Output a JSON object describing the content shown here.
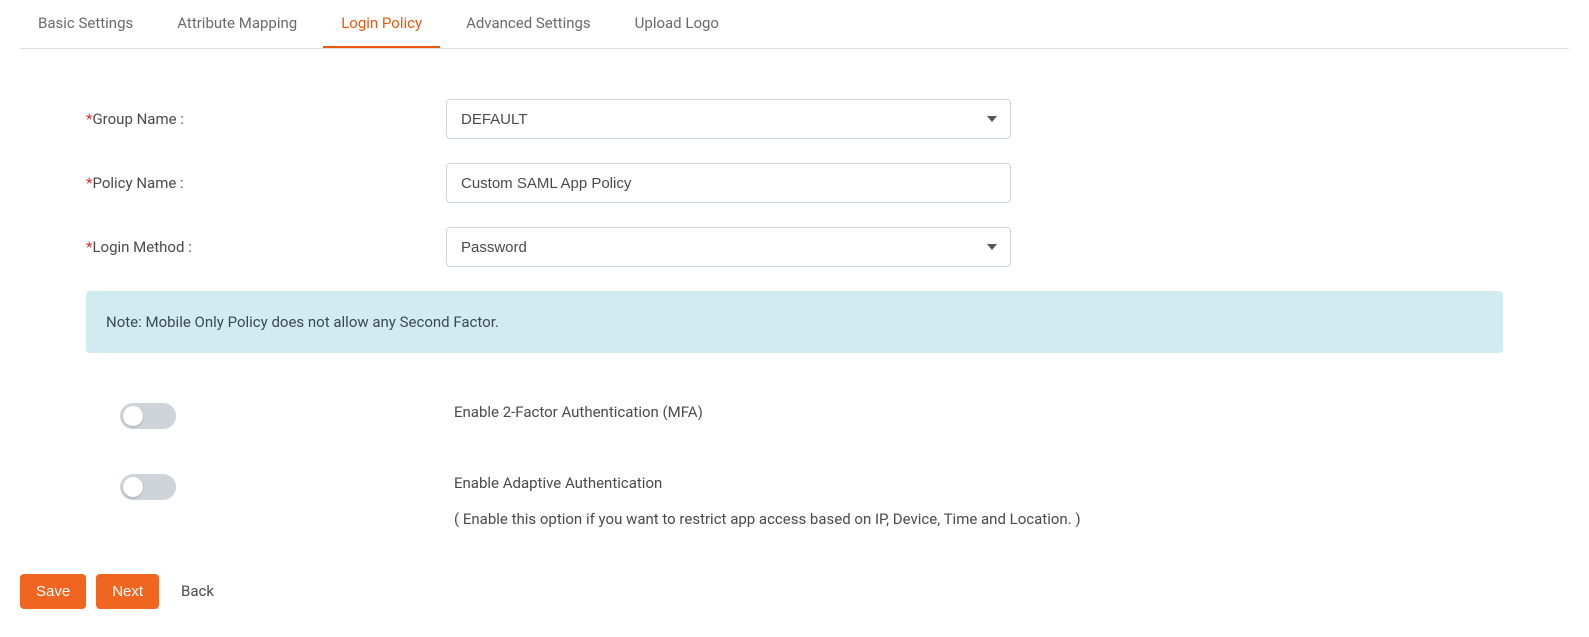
{
  "tabs": [
    {
      "label": "Basic Settings",
      "active": false
    },
    {
      "label": "Attribute Mapping",
      "active": false
    },
    {
      "label": "Login Policy",
      "active": true
    },
    {
      "label": "Advanced Settings",
      "active": false
    },
    {
      "label": "Upload Logo",
      "active": false
    }
  ],
  "form": {
    "group_name": {
      "label": "Group Name :",
      "value": "DEFAULT"
    },
    "policy_name": {
      "label": "Policy Name :",
      "value": "Custom SAML App Policy"
    },
    "login_method": {
      "label": "Login Method :",
      "value": "Password"
    }
  },
  "note": "Note: Mobile Only Policy does not allow any Second Factor.",
  "toggles": {
    "mfa": {
      "label": "Enable 2-Factor Authentication (MFA)"
    },
    "adaptive": {
      "label": "Enable Adaptive Authentication",
      "desc": "( Enable this option if you want to restrict app access based on IP, Device, Time and Location. )"
    }
  },
  "buttons": {
    "save": "Save",
    "next": "Next",
    "back": "Back"
  }
}
